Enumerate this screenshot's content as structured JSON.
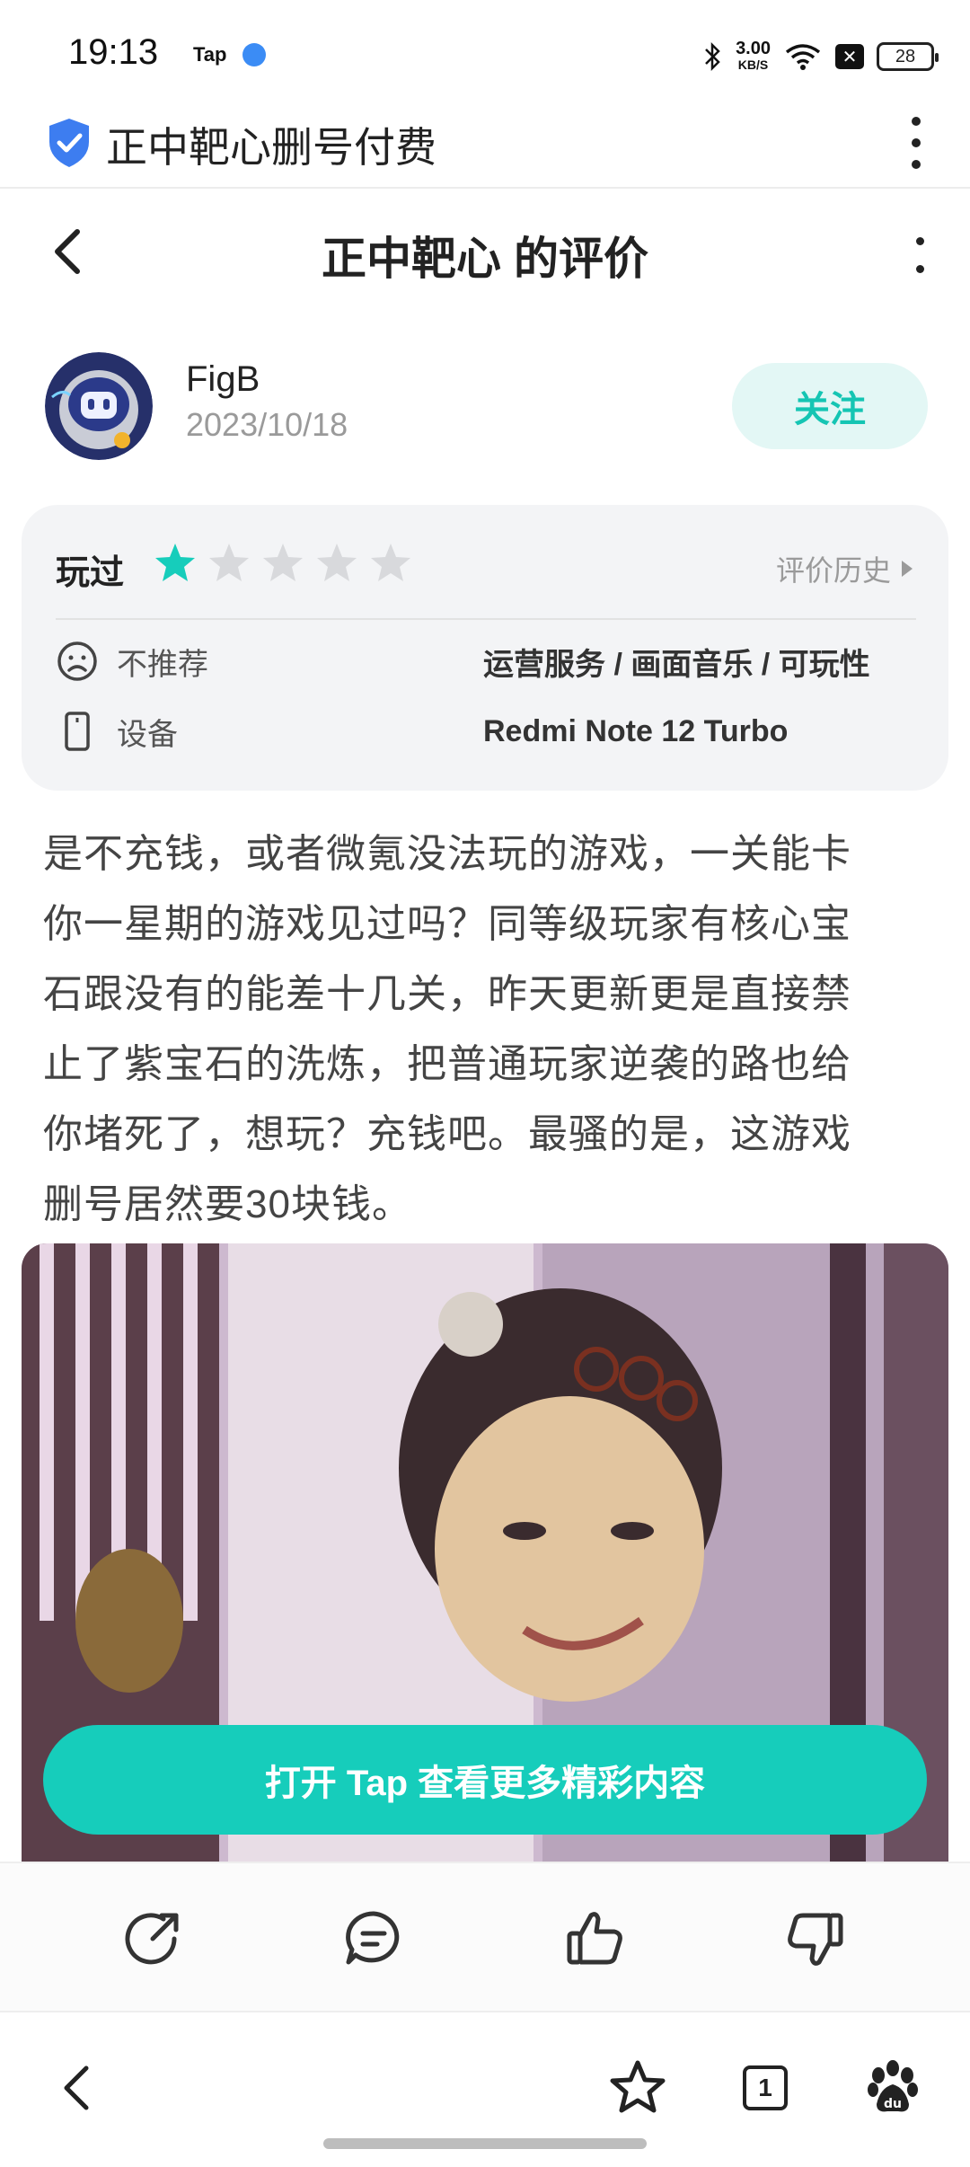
{
  "status_bar": {
    "time": "19:13",
    "app_badge": "Tap",
    "net_speed": "3.00",
    "net_unit": "KB/S",
    "battery": "28"
  },
  "browser": {
    "title": "正中靶心删号付费"
  },
  "header": {
    "title": "正中靶心 的评价"
  },
  "user": {
    "name": "FigB",
    "date": "2023/10/18",
    "follow_label": "关注"
  },
  "rating": {
    "played_label": "玩过",
    "stars": 1,
    "stars_max": 5,
    "history_label": "评价历史",
    "recommend_label": "不推荐",
    "recommend_tags": "运营服务 / 画面音乐 / 可玩性",
    "device_label": "设备",
    "device_value": "Redmi Note 12 Turbo"
  },
  "review": {
    "lines": [
      "是不充钱，或者微氪没法玩的游戏，一关能卡",
      "你一星期的游戏见过吗？同等级玩家有核心宝",
      "石跟没有的能差十几关，昨天更新更是直接禁",
      "止了紫宝石的洗炼，把普通玩家逆袭的路也给",
      "你堵死了，想玩？充钱吧。最骚的是，这游戏",
      "删号居然要30块钱。"
    ]
  },
  "cta": {
    "label": "打开 Tap 查看更多精彩内容"
  },
  "nav": {
    "tab_count": "1"
  },
  "colors": {
    "accent": "#16cdbb",
    "follow_bg": "#e3f7f5",
    "card_bg": "#f3f4f6"
  }
}
